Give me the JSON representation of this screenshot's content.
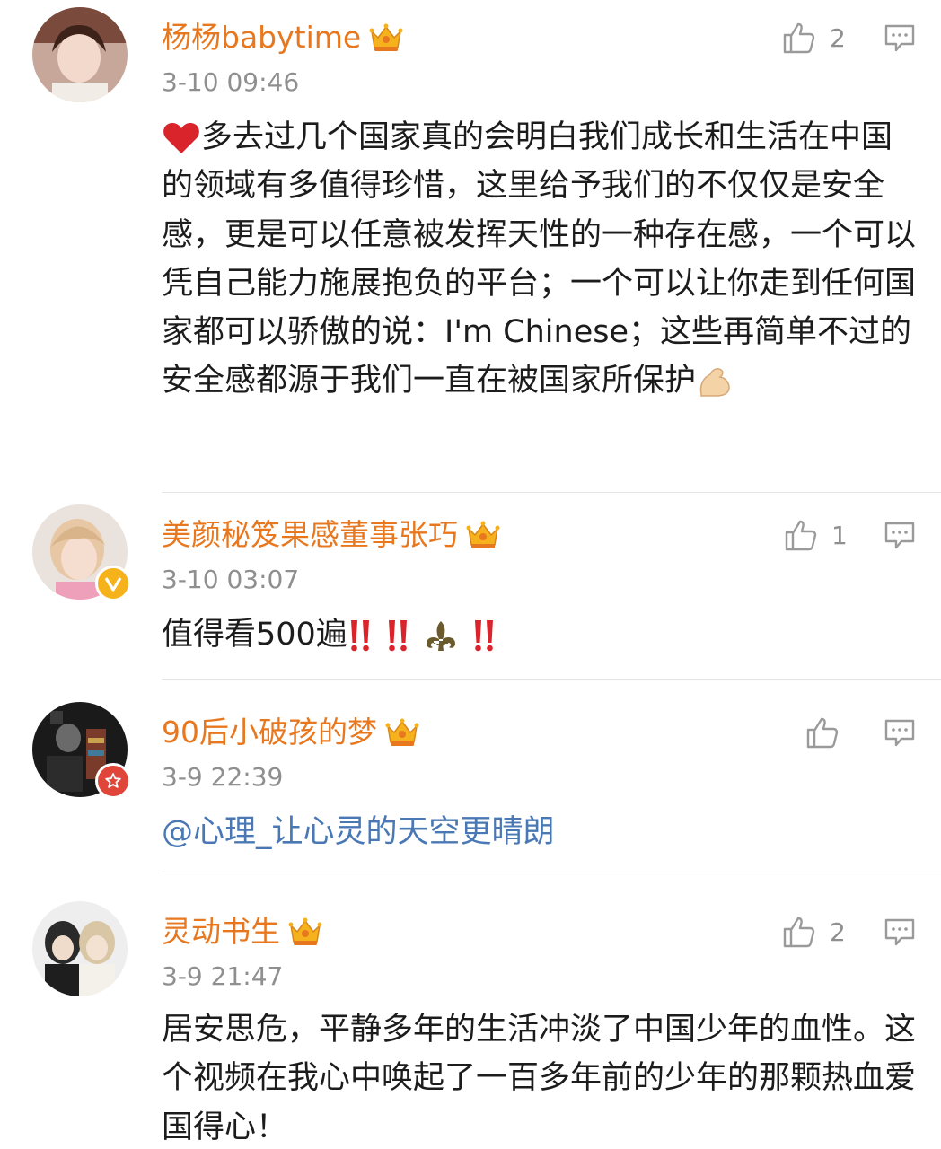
{
  "comments": [
    {
      "username": "杨杨babytime",
      "time": "3-10 09:46",
      "likes": "2",
      "body_before": "多去过几个国家真的会明白我们成长和生活在中国的领域有多值得珍惜，这里给予我们的不仅仅是安全感，更是可以任意被发挥天性的一种存在感，一个可以凭自己能力施展抱负的平台；一个可以让你走到任何国家都可以骄傲的说：I'm Chinese；这些再简单不过的安全感都源于我们一直在被国家所保护",
      "leading_icon": "red-heart-icon",
      "trailing_icon": "flexed-biceps-icon"
    },
    {
      "username": "美颜秘笈果感董事张巧",
      "time": "3-10 03:07",
      "likes": "1",
      "body_text": "值得看500遍",
      "icons": [
        "double-exclamation-icon",
        "double-exclamation-icon",
        "fleur-de-lis-icon",
        "double-exclamation-icon"
      ],
      "avatar_badge": "verified-v-badge"
    },
    {
      "username": "90后小破孩的梦",
      "time": "3-9 22:39",
      "likes": "",
      "mention": "@心理_让心灵的天空更晴朗",
      "avatar_badge": "star-badge"
    },
    {
      "username": "灵动书生",
      "time": "3-9 21:47",
      "likes": "2",
      "body_text": "居安思危，平静多年的生活冲淡了中国少年的血性。这个视频在我心中唤起了一百多年前的少年的那颗热血爱国得心！"
    }
  ],
  "colors": {
    "username": "#e8781f",
    "timestamp": "#8f8f8f",
    "mention": "#4a78b5",
    "text": "#1c1c1c"
  }
}
